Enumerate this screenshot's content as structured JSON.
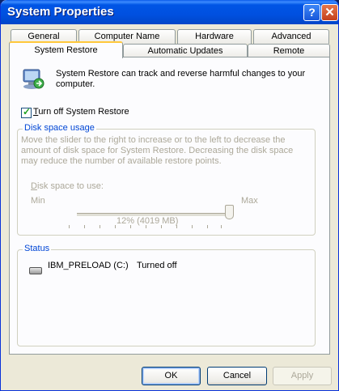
{
  "window": {
    "title": "System Properties"
  },
  "title_buttons": {
    "help": "?",
    "close": "✕"
  },
  "tabs": {
    "back": [
      "General",
      "Computer Name",
      "Hardware",
      "Advanced"
    ],
    "front": [
      "System Restore",
      "Automatic Updates",
      "Remote"
    ]
  },
  "panel": {
    "intro_text": "System Restore can track and reverse harmful changes to your computer.",
    "turn_off_label_key": "T",
    "turn_off_label_rest": "urn off System Restore",
    "turn_off_checked": true,
    "disk_group": {
      "legend": "Disk space usage",
      "description": "Move the slider to the right to increase or to the left to decrease the amount of disk space for System Restore. Decreasing the disk space may reduce the number of available restore points.",
      "slider_label_key": "D",
      "slider_label_rest": "isk space to use:",
      "min_label": "Min",
      "max_label": "Max",
      "value_text": "12% (4019 MB)",
      "slider_level": 1.0
    },
    "status_group": {
      "legend": "Status",
      "drive_name": "IBM_PRELOAD (C:)",
      "drive_status": "Turned off"
    }
  },
  "buttons": {
    "ok": "OK",
    "cancel": "Cancel",
    "apply": "Apply"
  }
}
